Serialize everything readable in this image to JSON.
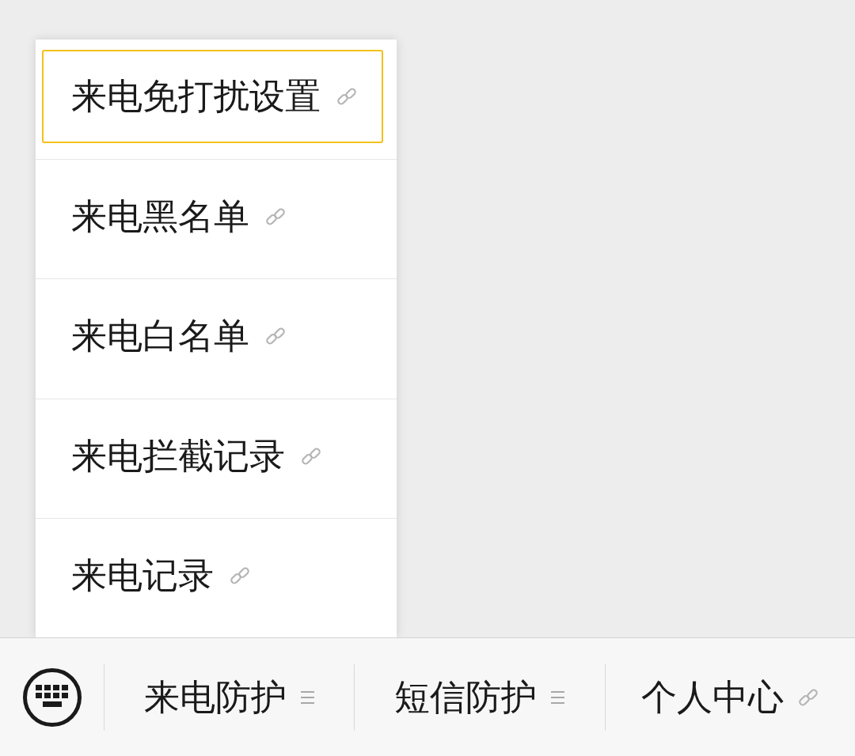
{
  "popup_menu": {
    "items": [
      {
        "label": "来电免打扰设置",
        "selected": true
      },
      {
        "label": "来电黑名单",
        "selected": false
      },
      {
        "label": "来电白名单",
        "selected": false
      },
      {
        "label": "来电拦截记录",
        "selected": false
      },
      {
        "label": "来电记录",
        "selected": false
      }
    ]
  },
  "bottom_bar": {
    "tabs": [
      {
        "label": "来电防护",
        "kind": "submenu"
      },
      {
        "label": "短信防护",
        "kind": "submenu"
      },
      {
        "label": "个人中心",
        "kind": "link"
      }
    ]
  }
}
